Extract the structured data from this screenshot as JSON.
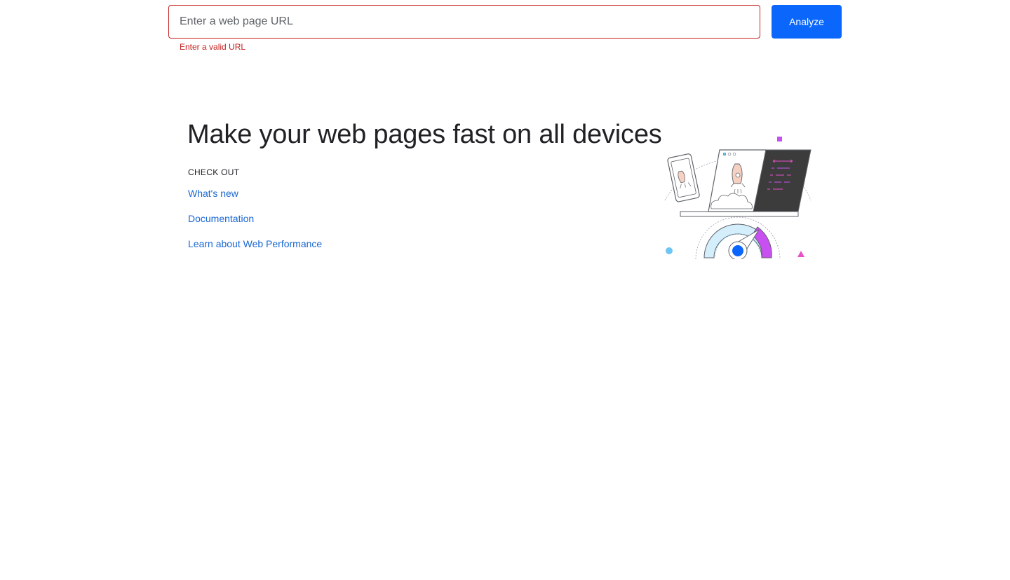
{
  "search": {
    "placeholder": "Enter a web page URL",
    "value": "",
    "error": "Enter a valid URL",
    "analyze_label": "Analyze"
  },
  "hero": {
    "title": "Make your web pages fast on all devices",
    "section_label": "CHECK OUT",
    "links": [
      {
        "label": "What's new"
      },
      {
        "label": "Documentation"
      },
      {
        "label": "Learn about Web Performance"
      }
    ]
  },
  "colors": {
    "accent": "#0b67fb",
    "error": "#c5221f",
    "link": "#1967d2"
  },
  "illustration": {
    "icon": "pagespeed-illustration-icon"
  }
}
